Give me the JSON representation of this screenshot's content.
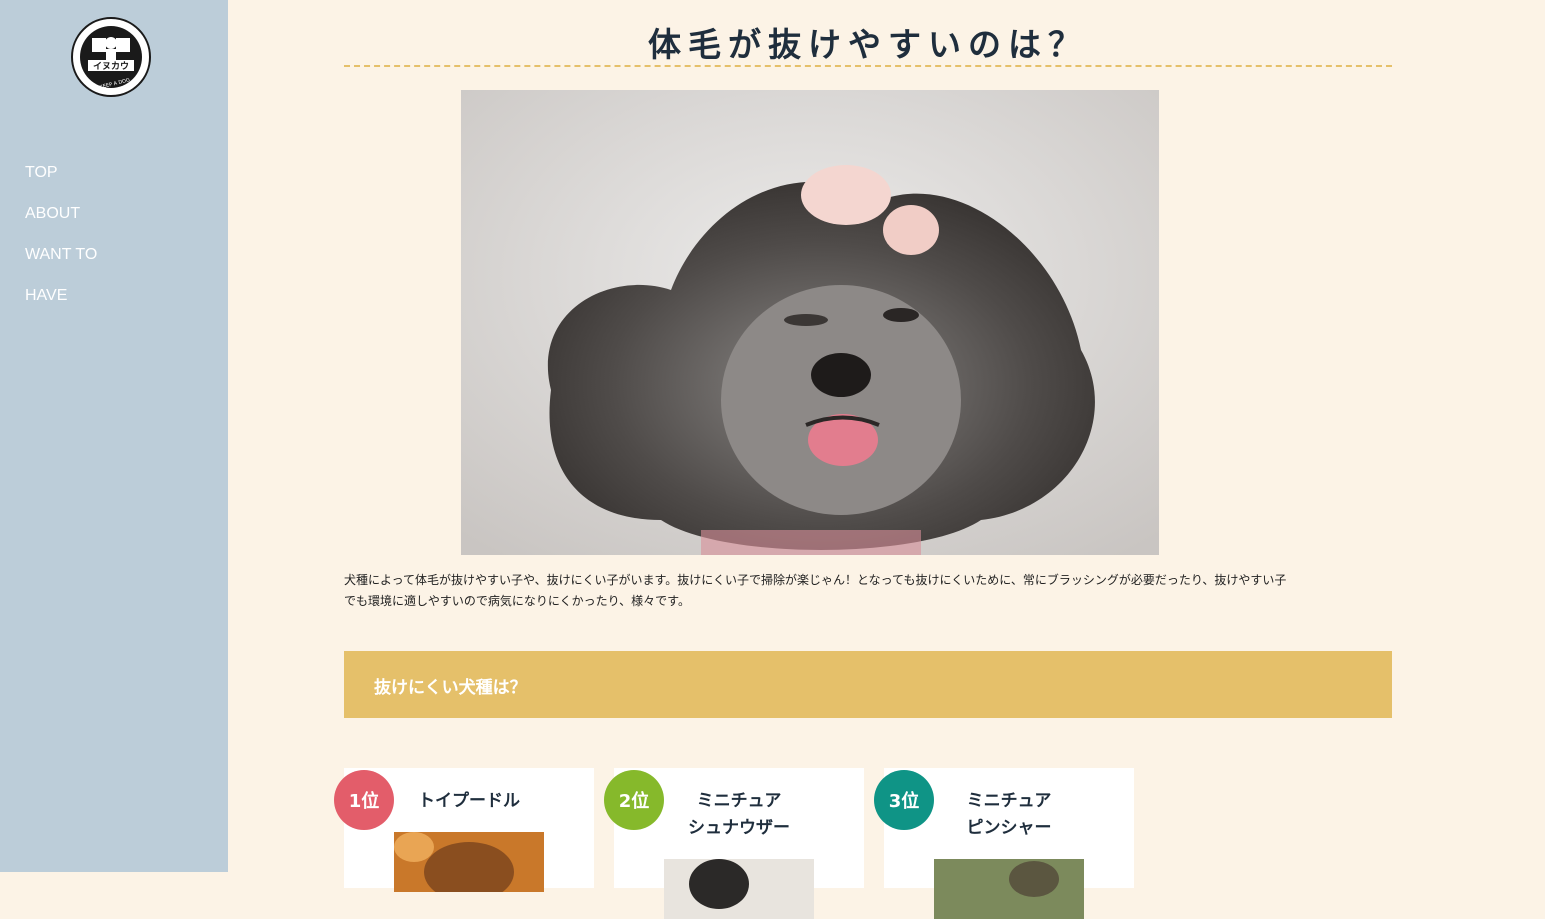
{
  "logo": {
    "top_text": "WHAT ARE THE BASIC RULES FOR KEEPING A DOG",
    "name": "イヌカウ",
    "bottom_text": "TO KEEP A DOG"
  },
  "nav": {
    "items": [
      {
        "label": "TOP"
      },
      {
        "label": "ABOUT"
      },
      {
        "label": "WANT TO"
      },
      {
        "label": "HAVE"
      }
    ]
  },
  "main": {
    "title": "体毛が抜けやすいのは？",
    "intro_line1": "犬種によって体毛が抜けやすい子や、抜けにくい子がいます。抜けにくい子で掃除が楽じゃん！となっても抜けにくいために、常にブラッシングが必要だったり、抜けやすい子",
    "intro_line2": "でも環境に適しやすいので病気になりにくかったり、様々です。",
    "section_title": "抜けにくい犬種は？"
  },
  "ranking": [
    {
      "rank": "1位",
      "name_line1": "トイプードル",
      "name_line2": "",
      "badge_color": "#e35d6a"
    },
    {
      "rank": "2位",
      "name_line1": "ミニチュア",
      "name_line2": "シュナウザー",
      "badge_color": "#86b92b"
    },
    {
      "rank": "3位",
      "name_line1": "ミニチュア",
      "name_line2": "ピンシャー",
      "badge_color": "#0f9486"
    }
  ],
  "colors": {
    "sidebar_bg": "#bccdd9",
    "page_bg": "#fcf3e6",
    "accent": "#e5c06a",
    "title_text": "#1f2e3d"
  }
}
